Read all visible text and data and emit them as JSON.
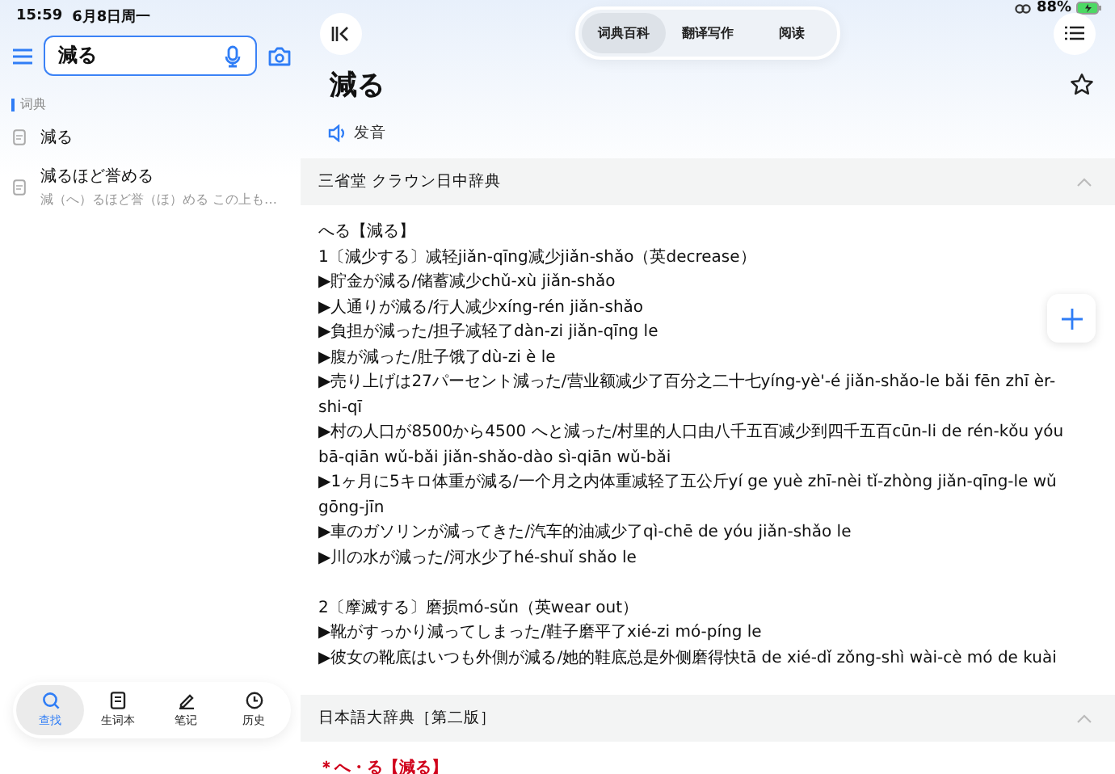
{
  "status_bar": {
    "time": "15:59",
    "date": "6月8日周一",
    "battery": "88%"
  },
  "search": {
    "value": "減る"
  },
  "sidebar": {
    "section": "词典",
    "items": [
      {
        "title": "減る"
      },
      {
        "title": "減るほど誉める",
        "subtitle": "減（へ）るほど誉（ほ）める この上も…"
      }
    ]
  },
  "bottom_tabs": [
    {
      "label": "查找",
      "selected": true
    },
    {
      "label": "生词本",
      "selected": false
    },
    {
      "label": "笔记",
      "selected": false
    },
    {
      "label": "历史",
      "selected": false
    }
  ],
  "mode_tabs": [
    {
      "label": "词典百科",
      "selected": true
    },
    {
      "label": "翻译写作",
      "selected": false
    },
    {
      "label": "阅读",
      "selected": false
    }
  ],
  "entry": {
    "word": "減る",
    "pronounce": "发音",
    "favorite": false
  },
  "dictionaries": [
    {
      "name": "三省堂 クラウン日中辞典",
      "expanded": true,
      "lines": [
        {
          "kind": "head",
          "text": "へる【減る】"
        },
        {
          "kind": "sense",
          "text": "1〔減少する〕减轻jiǎn-qīng减少jiǎn-shǎo（英decrease）"
        },
        {
          "kind": "example",
          "text": "▶貯金が減る/储蓄减少chǔ-xù jiǎn-shǎo"
        },
        {
          "kind": "example",
          "text": "▶人通りが減る/行人减少xíng-rén jiǎn-shǎo"
        },
        {
          "kind": "example",
          "text": "▶負担が減った/担子减轻了dàn-zi jiǎn-qīng le"
        },
        {
          "kind": "example",
          "text": "▶腹が減った/肚子饿了dù-zi è le"
        },
        {
          "kind": "example",
          "text": "▶売り上げは27パーセント減った/营业额减少了百分之二十七yíng-yè'-é jiǎn-shǎo-le bǎi fēn zhī èr-shi-qī"
        },
        {
          "kind": "example",
          "text": "▶村の人口が8500から4500 へと減った/村里的人口由八千五百减少到四千五百cūn-li de rén-kǒu yóu bā-qiān wǔ-bǎi jiǎn-shǎo-dào sì-qiān wǔ-bǎi"
        },
        {
          "kind": "example",
          "text": "▶1ヶ月に5キロ体重が減る/一个月之内体重减轻了五公斤yí ge yuè zhī-nèi tǐ-zhòng jiǎn-qīng-le wǔ gōng-jīn"
        },
        {
          "kind": "example",
          "text": "▶車のガソリンが減ってきた/汽车的油减少了qì-chē de yóu jiǎn-shǎo le"
        },
        {
          "kind": "example",
          "text": "▶川の水が減った/河水少了hé-shuǐ shǎo le"
        },
        {
          "kind": "gap"
        },
        {
          "kind": "sense",
          "text": "2〔摩滅する〕磨损mó-sǔn（英wear out）"
        },
        {
          "kind": "example",
          "text": "▶靴がすっかり減ってしまった/鞋子磨平了xié-zi mó-píng le"
        },
        {
          "kind": "example",
          "text": "▶彼女の靴底はいつも外側が減る/她的鞋底总是外侧磨得快tā de xié-dǐ zǒng-shì wài-cè mó de kuài"
        }
      ]
    },
    {
      "name": "日本語大辞典［第二版］",
      "expanded": true,
      "lines": [
        {
          "kind": "red-head",
          "text": "＊へ・る【減る】"
        }
      ]
    }
  ]
}
